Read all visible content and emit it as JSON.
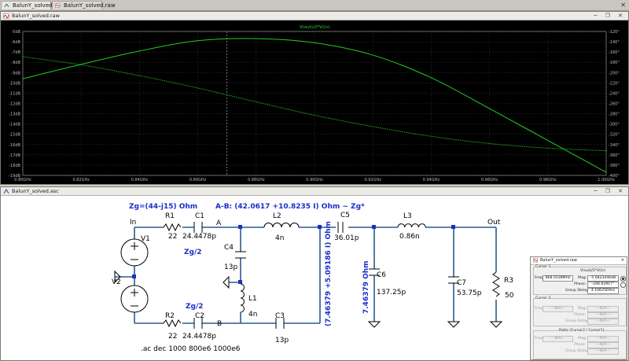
{
  "tabs": [
    {
      "label": "BalunY_solved.asc"
    },
    {
      "label": "BalunY_solved.raw"
    }
  ],
  "plot_window": {
    "title": "BalunY_solved.raw",
    "trace_label": "V(out)/2*V(in)"
  },
  "schematic_window": {
    "title": "BalunY_solved.asc"
  },
  "chart_data": {
    "type": "line",
    "title": "V(out)/2*V(in)",
    "x": [
      0.8,
      0.82,
      0.84,
      0.86,
      0.88,
      0.9,
      0.92,
      0.94,
      0.96,
      0.98,
      1.0
    ],
    "xticks": [
      "0.80GHz",
      "0.82GHz",
      "0.84GHz",
      "0.86GHz",
      "0.88GHz",
      "0.90GHz",
      "0.92GHz",
      "0.94GHz",
      "0.96GHz",
      "0.98GHz",
      "1.00GHz"
    ],
    "xlim": [
      0.8,
      1.0
    ],
    "yticks_left": [
      "-5dB",
      "-6dB",
      "-7dB",
      "-8dB",
      "-9dB",
      "-10dB",
      "-11dB",
      "-12dB",
      "-13dB",
      "-14dB",
      "-15dB",
      "-16dB",
      "-17dB",
      "-18dB",
      "-19dB"
    ],
    "ylim_left": [
      -19,
      -5
    ],
    "yticks_right": [
      "-120°",
      "-140°",
      "-160°",
      "-180°",
      "-200°",
      "-220°",
      "-240°",
      "-260°",
      "-280°",
      "-300°",
      "-320°",
      "-340°",
      "-360°",
      "-380°",
      "-400°"
    ],
    "ylim_right": [
      -400,
      -120
    ],
    "series": [
      {
        "name": "",
        "axis": "left",
        "style": "solid",
        "values": [
          -9.6,
          -8.2,
          -6.9,
          -5.9,
          -5.7,
          -6.1,
          -7.3,
          -9.5,
          -12.5,
          -15.6,
          -18.7
        ]
      },
      {
        "name": "",
        "axis": "right",
        "style": "dotted",
        "values": [
          -169,
          -185,
          -206,
          -230,
          -257,
          -283,
          -305,
          -324,
          -338,
          -347,
          -352
        ]
      }
    ],
    "cursor_x": 0.87,
    "grid": true
  },
  "schematic": {
    "labels": {
      "zg": "Zg=(44-j15) Ohm",
      "ab": "A-B: (42.0617 +10.8235 I) Ohm ~ Zg*",
      "in": "In",
      "out": "Out",
      "a": "A",
      "b": "B",
      "zg2_top": "Zg/2",
      "zg2_bot": "Zg/2",
      "zmid": "(7.46379 +5.09186 I) Ohm",
      "z74": "7.46379 Ohm",
      "ac": ".ac dec 1000 800e6 1000e6"
    },
    "components": {
      "r1": {
        "name": "R1",
        "value": "22"
      },
      "c1": {
        "name": "C1",
        "value": "24.4478p"
      },
      "r2": {
        "name": "R2",
        "value": "22"
      },
      "c2": {
        "name": "C2",
        "value": "24.4478p"
      },
      "c4": {
        "name": "C4",
        "value": "13p"
      },
      "l1": {
        "name": "L1",
        "value": "4n"
      },
      "l2": {
        "name": "L2",
        "value": "4n"
      },
      "c3": {
        "name": "C3",
        "value": "13p"
      },
      "c5": {
        "name": "C5",
        "value": "36.01p"
      },
      "l3": {
        "name": "L3",
        "value": "0.86n"
      },
      "c6": {
        "name": "C6",
        "value": "137.25p"
      },
      "c7": {
        "name": "C7",
        "value": "53.75p"
      },
      "r3": {
        "name": "R3",
        "value": "50"
      },
      "v1": {
        "name": "V1"
      },
      "v2": {
        "name": "V2"
      }
    }
  },
  "cursor_panel": {
    "title": "BalunY_solved.raw",
    "cursor1": {
      "group": "Cursor 1",
      "trace": "V(out)/2*V(in)",
      "freq_label": "Freq:",
      "freq": "868.0338MHz",
      "mag_label": "Mag:",
      "mag": "-5.6823446dB",
      "phase_label": "Phase:",
      "phase": "-246.63917°",
      "gd_label": "Group Delay:",
      "gd": "4.1062569ns"
    },
    "cursor2": {
      "group": "Cursor 2",
      "freq_label": "Freq:",
      "freq": "---N/A---",
      "mag_label": "Mag:",
      "mag": "---N/A---",
      "phase_label": "Phase:",
      "phase": "---N/A---",
      "gd_label": "Group Delay:",
      "gd": "---N/A---"
    },
    "ratio": {
      "group": "Ratio (Cursor2 / Cursor1)",
      "freq_label": "Freq:",
      "freq": "---N/A---",
      "mag_label": "Mag:",
      "mag": "---N/A---",
      "phase_label": "Phase:",
      "phase": "---N/A---",
      "gd_label": "Group Delay:",
      "gd": "---N/A---"
    }
  },
  "colors": {
    "plot_bg": "#000000",
    "trace": "#22cc22",
    "grid": "#3a3a3a",
    "schematic_bg": "#ffffff",
    "wire": "#2b5c8f",
    "label_blue": "#1a2fc8"
  }
}
